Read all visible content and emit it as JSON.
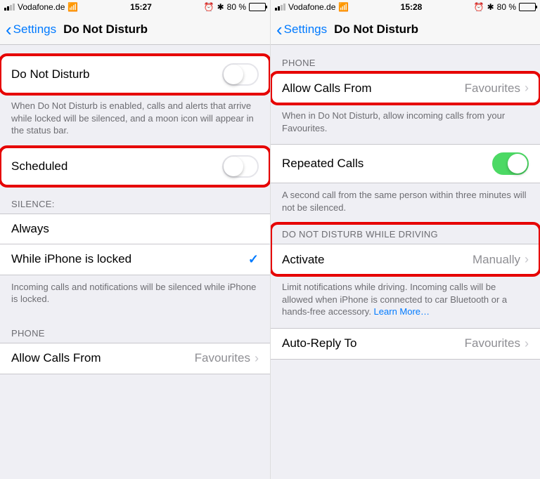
{
  "left": {
    "status": {
      "carrier": "Vodafone.de",
      "time": "15:27",
      "battery_pct": "80 %"
    },
    "nav": {
      "back": "Settings",
      "title": "Do Not Disturb"
    },
    "dnd": {
      "label": "Do Not Disturb",
      "on": false
    },
    "dnd_footer": "When Do Not Disturb is enabled, calls and alerts that arrive while locked will be silenced, and a moon icon will appear in the status bar.",
    "scheduled": {
      "label": "Scheduled",
      "on": false
    },
    "silence_header": "SILENCE:",
    "silence_options": [
      {
        "label": "Always",
        "checked": false
      },
      {
        "label": "While iPhone is locked",
        "checked": true
      }
    ],
    "silence_footer": "Incoming calls and notifications will be silenced while iPhone is locked.",
    "phone_header": "PHONE",
    "allow_calls": {
      "label": "Allow Calls From",
      "value": "Favourites"
    }
  },
  "right": {
    "status": {
      "carrier": "Vodafone.de",
      "time": "15:28",
      "battery_pct": "80 %"
    },
    "nav": {
      "back": "Settings",
      "title": "Do Not Disturb"
    },
    "phone_header": "PHONE",
    "allow_calls": {
      "label": "Allow Calls From",
      "value": "Favourites"
    },
    "allow_calls_footer": "When in Do Not Disturb, allow incoming calls from your Favourites.",
    "repeated": {
      "label": "Repeated Calls",
      "on": true
    },
    "repeated_footer": "A second call from the same person within three minutes will not be silenced.",
    "driving_header": "DO NOT DISTURB WHILE DRIVING",
    "activate": {
      "label": "Activate",
      "value": "Manually"
    },
    "driving_footer_pre": "Limit notifications while driving. Incoming calls will be allowed when iPhone is connected to car Bluetooth or a hands-free accessory. ",
    "driving_footer_link": "Learn More…",
    "auto_reply": {
      "label": "Auto-Reply To",
      "value": "Favourites"
    }
  }
}
